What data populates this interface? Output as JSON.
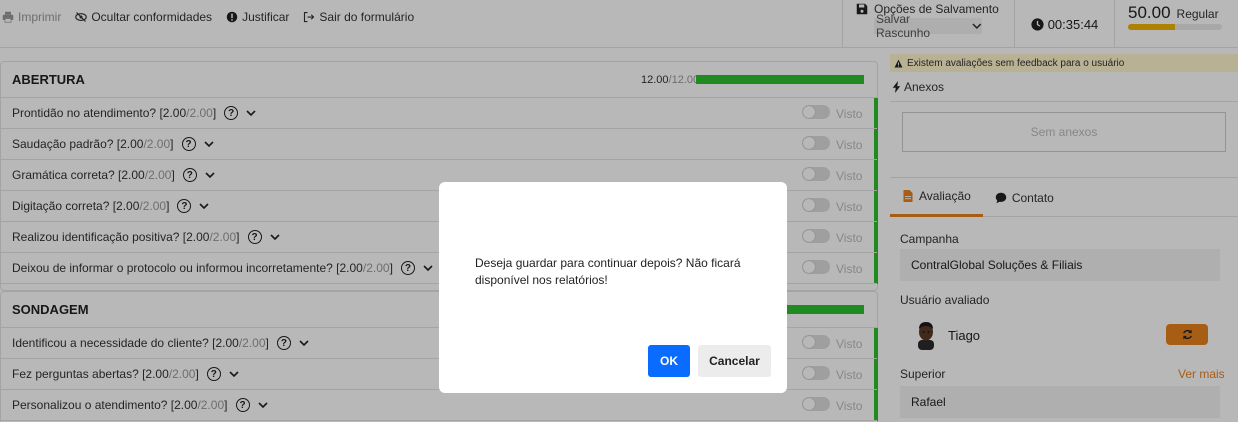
{
  "toolbar": {
    "print_label": "Imprimir",
    "hide_label": "Ocultar conformidades",
    "justify_label": "Justificar",
    "exit_label": "Sair do formulário"
  },
  "save_options": {
    "title": "Opções de Salvamento",
    "selected": "Salvar Rascunho"
  },
  "timer": "00:35:44",
  "score": {
    "value": "50.00",
    "label": "Regular",
    "fill": 0.5,
    "color": "#f2b400"
  },
  "sections": [
    {
      "title": "ABERTURA",
      "score": "12.00",
      "max": "/12.00",
      "questions": [
        {
          "text": "Prontidão no atendimento? [2.00",
          "max": "/2.00",
          "close": "]"
        },
        {
          "text": "Saudação padrão? [2.00",
          "max": "/2.00",
          "close": "]"
        },
        {
          "text": "Gramática correta? [2.00",
          "max": "/2.00",
          "close": "]"
        },
        {
          "text": "Digitação correta? [2.00",
          "max": "/2.00",
          "close": "]"
        },
        {
          "text": "Realizou identificação positiva? [2.00",
          "max": "/2.00",
          "close": "]"
        },
        {
          "text": "Deixou de informar o protocolo ou informou incorretamente? [2.00",
          "max": "/2.00",
          "close": "]"
        }
      ]
    },
    {
      "title": "SONDAGEM",
      "questions": [
        {
          "text": "Identificou a necessidade do cliente? [2.00",
          "max": "/2.00",
          "close": "]"
        },
        {
          "text": "Fez perguntas abertas? [2.00",
          "max": "/2.00",
          "close": "]"
        },
        {
          "text": "Personalizou o atendimento? [2.00",
          "max": "/2.00",
          "close": "]"
        }
      ]
    }
  ],
  "toggle_label": "Visto",
  "help_glyph": "?",
  "right": {
    "warning": "Existem avaliações sem feedback para o usuário",
    "attachments_title": "Anexos",
    "attachments_empty": "Sem anexos",
    "tabs": [
      "Avaliação",
      "Contato"
    ],
    "campaign_label": "Campanha",
    "campaign_value": "ContralGlobal Soluções & Filiais",
    "user_label": "Usuário avaliado",
    "user_name": "Tiago",
    "superior_label": "Superior",
    "more_link": "Ver mais",
    "superior_value": "Rafael"
  },
  "modal": {
    "message": "Deseja guardar para continuar depois? Não ficará disponível nos relatórios!",
    "ok": "OK",
    "cancel": "Cancelar"
  },
  "colors": {
    "accent": "#e8821c",
    "success": "#2bbf2b",
    "primary": "#0a6cff"
  }
}
